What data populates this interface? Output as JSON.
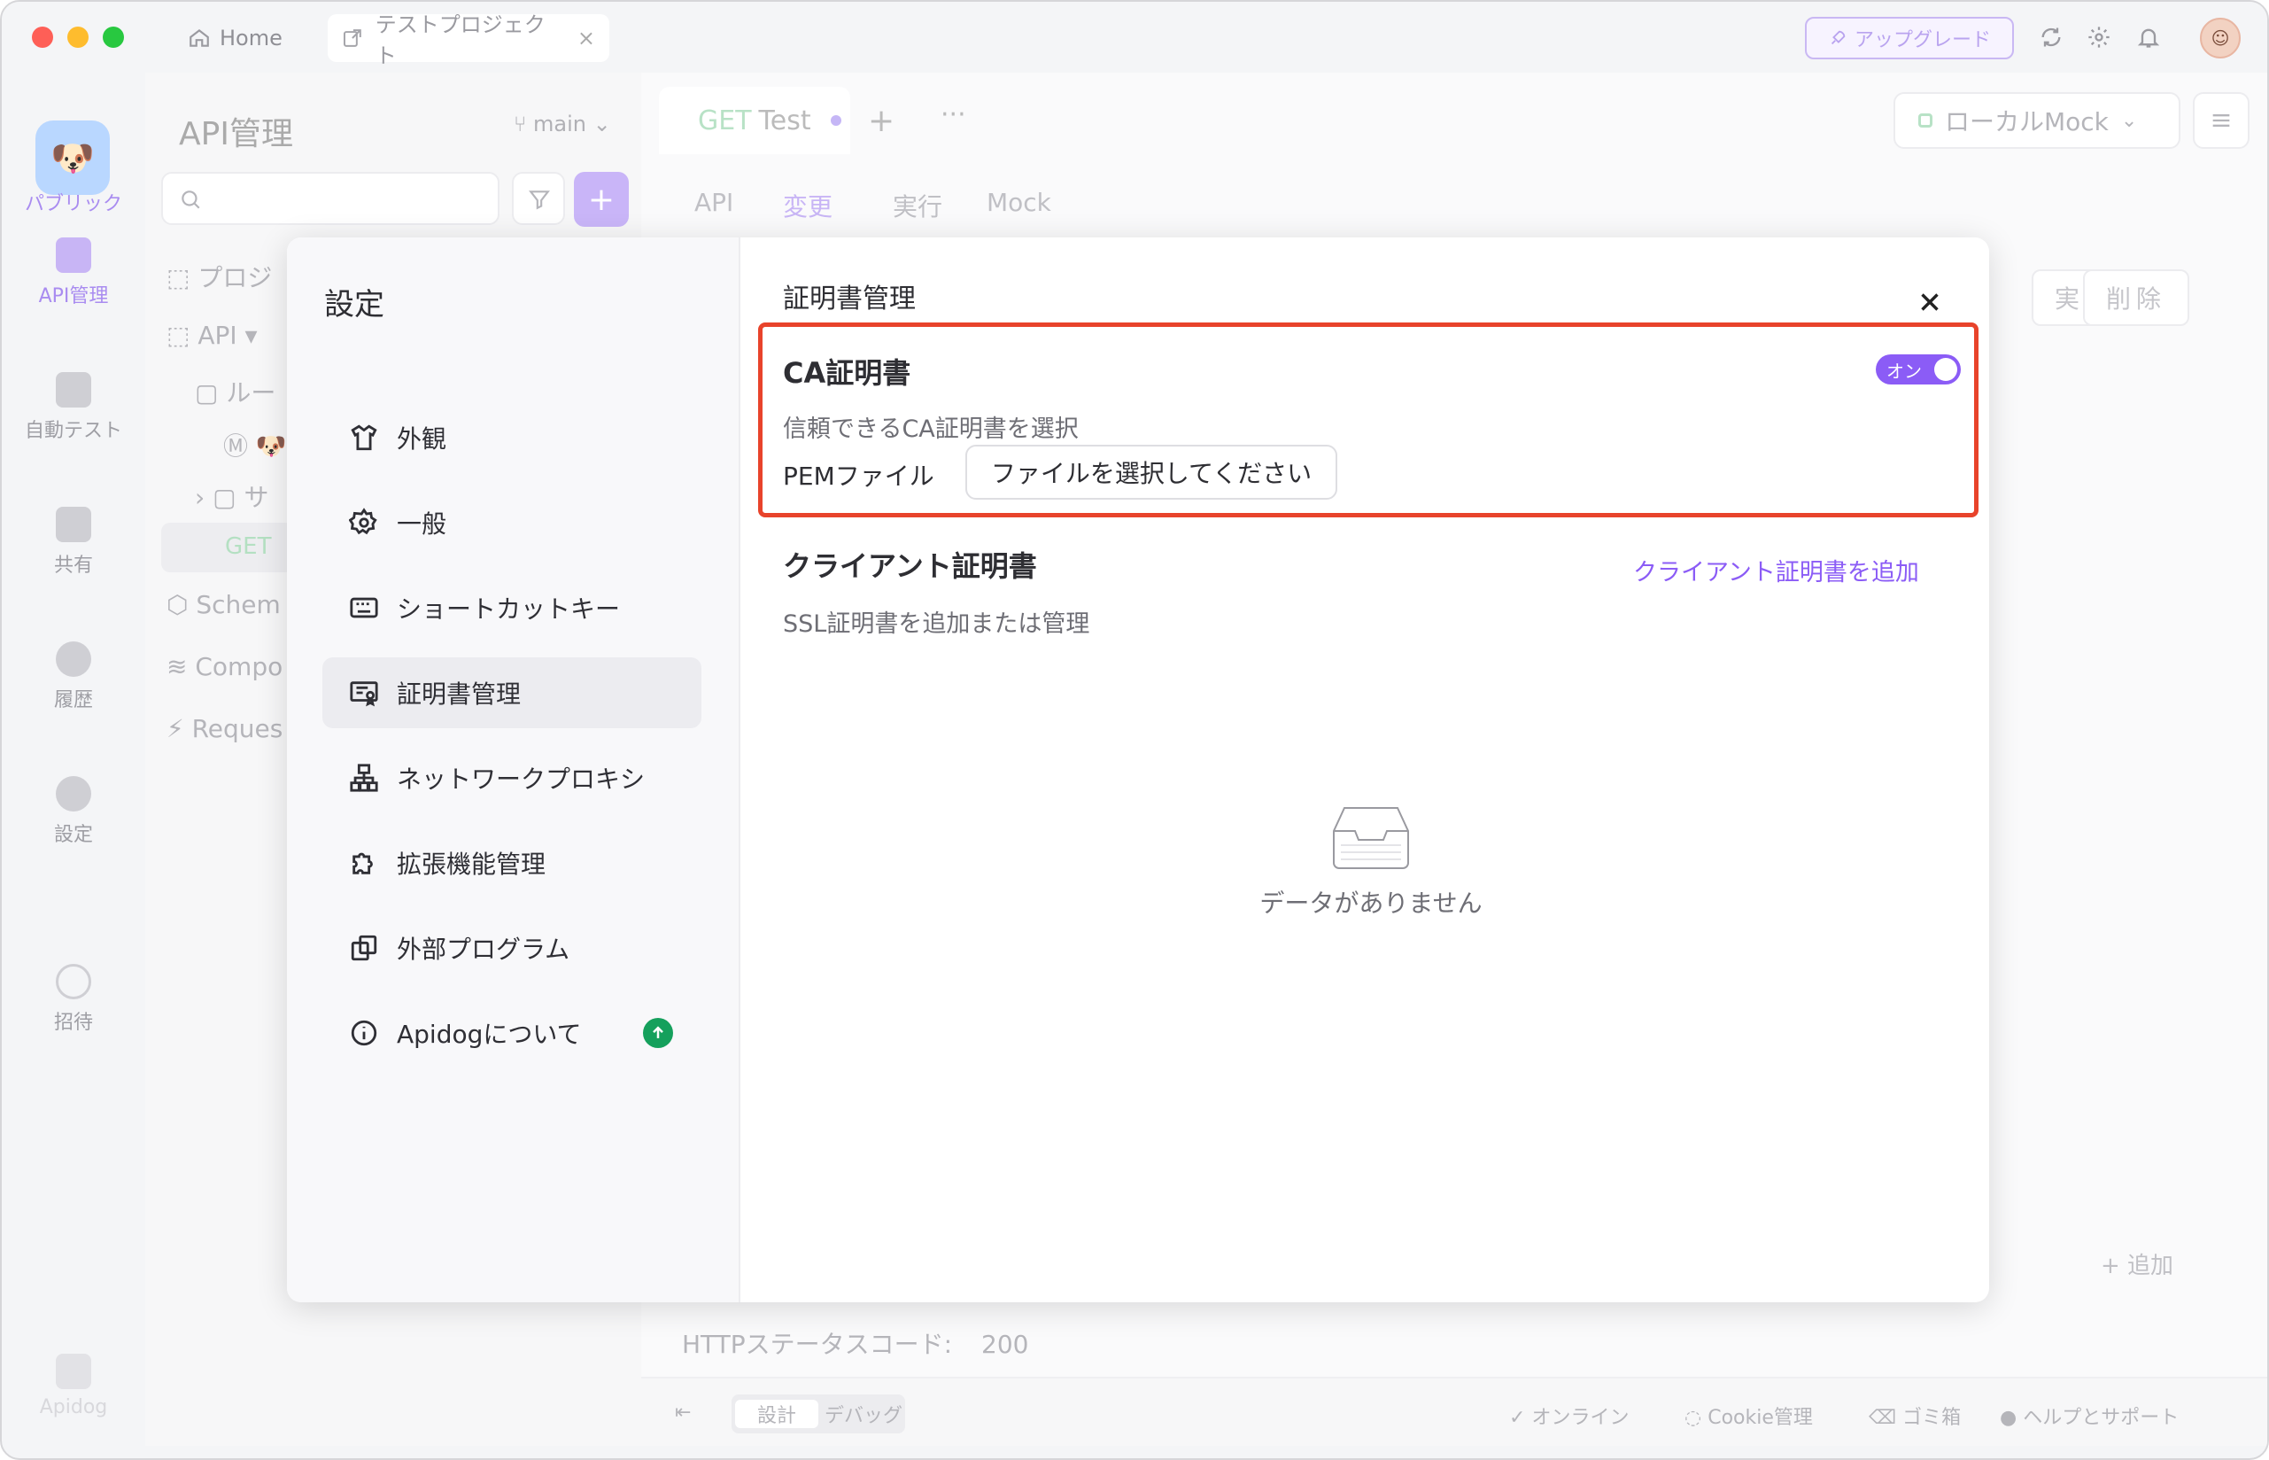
{
  "titlebar": {
    "home_label": "Home",
    "project_tab_label": "テストプロジェクト",
    "upgrade_label": "アップグレード"
  },
  "rail": {
    "items": [
      {
        "label": "パブリック"
      },
      {
        "label": "API管理"
      },
      {
        "label": "自動テスト"
      },
      {
        "label": "共有"
      },
      {
        "label": "履歴"
      },
      {
        "label": "設定"
      },
      {
        "label": "招待"
      },
      {
        "label": "Apidog"
      }
    ]
  },
  "project_panel": {
    "title": "API管理",
    "branch": "main",
    "tree": [
      {
        "label": "プロジ"
      },
      {
        "label": "API"
      },
      {
        "label": "ルー"
      },
      {
        "label": "サ"
      },
      {
        "label": "Schem"
      },
      {
        "label": "Compo"
      },
      {
        "label": "Reques"
      }
    ],
    "get_label": "GET"
  },
  "main": {
    "tab_method": "GET",
    "tab_name": "Test",
    "env_label": "ローカルMock",
    "subtabs": [
      "API",
      "変更",
      "実行",
      "Mock"
    ],
    "run_label": "実行",
    "delete_label": "削除",
    "status_code_label": "HTTPステータスコード:",
    "status_code_value": "200",
    "add_label": "+ 追加",
    "bottom": {
      "design": "設計",
      "debug": "デバッグ",
      "online": "オンライン",
      "cookie": "Cookie管理",
      "trash": "ゴミ箱",
      "help": "ヘルプとサポート"
    }
  },
  "dialog": {
    "title": "設定",
    "menu": [
      {
        "label": "外観",
        "icon": "shirt-icon"
      },
      {
        "label": "一般",
        "icon": "gear-icon"
      },
      {
        "label": "ショートカットキー",
        "icon": "keyboard-icon"
      },
      {
        "label": "証明書管理",
        "icon": "certificate-icon",
        "active": true
      },
      {
        "label": "ネットワークプロキシ",
        "icon": "network-icon"
      },
      {
        "label": "拡張機能管理",
        "icon": "puzzle-icon"
      },
      {
        "label": "外部プログラム",
        "icon": "external-program-icon"
      },
      {
        "label": "Apidogについて",
        "icon": "info-icon"
      }
    ],
    "content": {
      "title": "証明書管理",
      "ca": {
        "title": "CA証明書",
        "toggle_label": "オン",
        "description": "信頼できるCA証明書を選択",
        "pem_label": "PEMファイル",
        "file_button": "ファイルを選択してください"
      },
      "client": {
        "title": "クライアント証明書",
        "add_link": "クライアント証明書を追加",
        "description": "SSL証明書を追加または管理",
        "empty_text": "データがありません"
      }
    }
  },
  "colors": {
    "accent": "#8b5cf6",
    "highlight_border": "#e8432b",
    "update_badge": "#15a05c"
  }
}
